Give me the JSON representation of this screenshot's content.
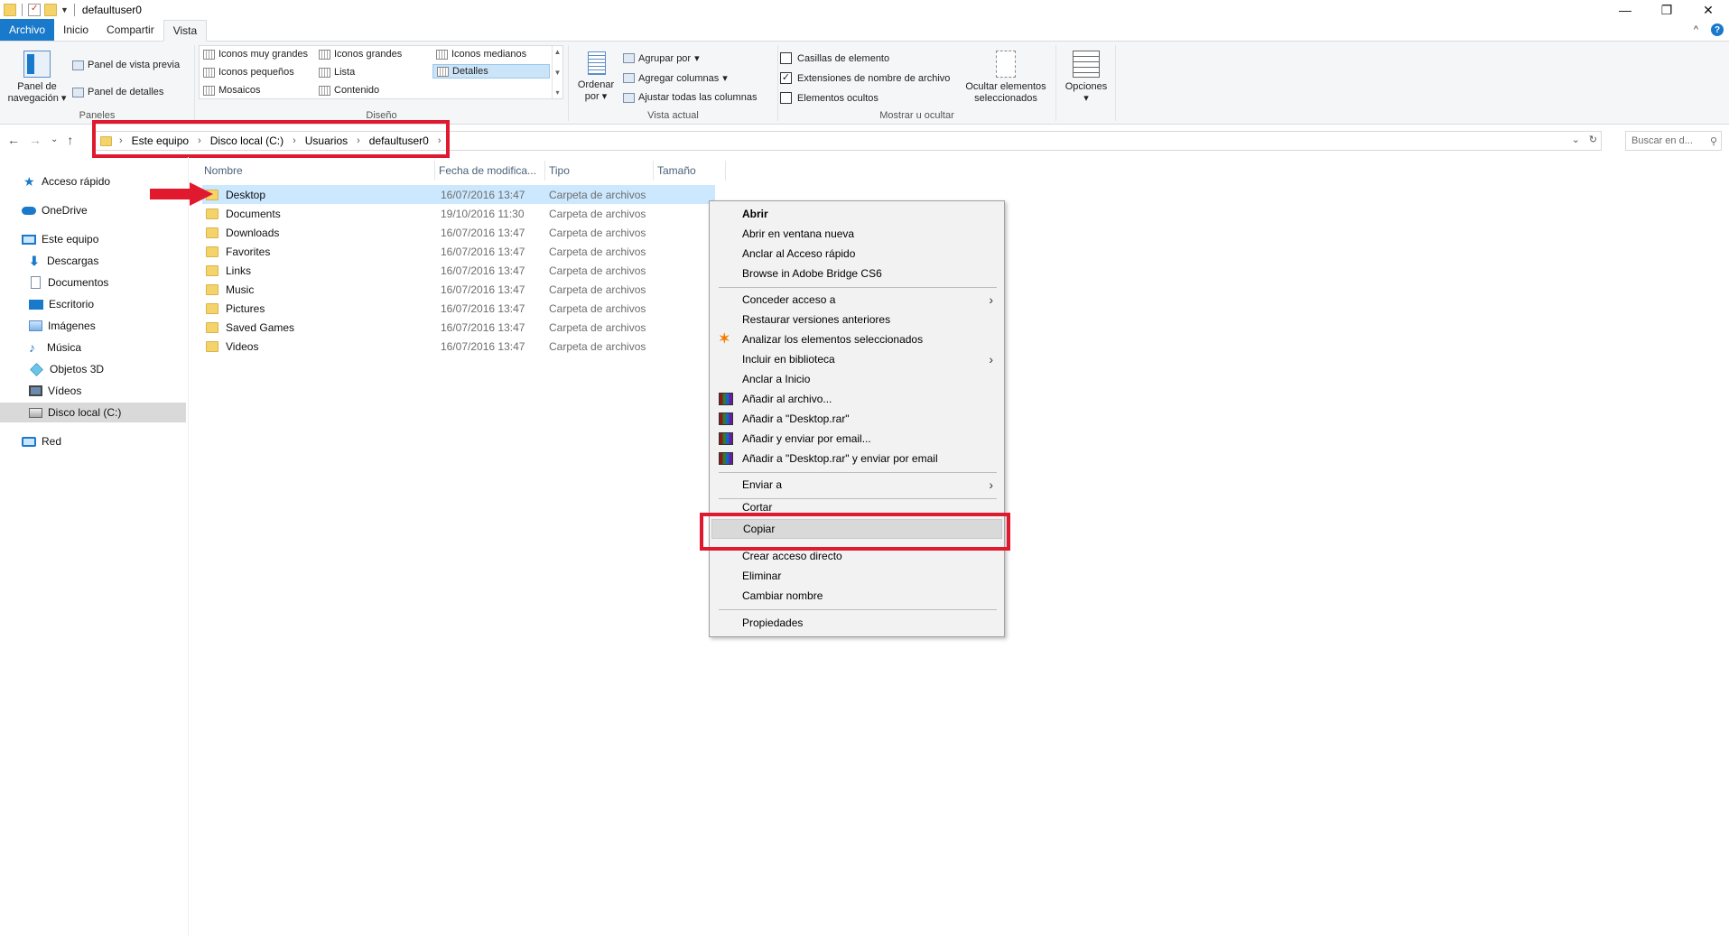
{
  "window": {
    "title": "defaultuser0"
  },
  "ribbon_tabs": [
    "Archivo",
    "Inicio",
    "Compartir",
    "Vista"
  ],
  "ribbon": {
    "paneles": {
      "label": "Paneles",
      "nav_pane": "Panel de navegación",
      "preview_pane": "Panel de vista previa",
      "details_pane": "Panel de detalles"
    },
    "diseno": {
      "label": "Diseño",
      "items": [
        "Iconos muy grandes",
        "Iconos grandes",
        "Iconos medianos",
        "Iconos pequeños",
        "Lista",
        "Detalles",
        "Mosaicos",
        "Contenido"
      ],
      "selected": "Detalles"
    },
    "vista_actual": {
      "label": "Vista actual",
      "sort_by": "Ordenar por",
      "group_by": "Agrupar por",
      "add_columns": "Agregar columnas",
      "fit_columns": "Ajustar todas las columnas"
    },
    "mostrar": {
      "label": "Mostrar u ocultar",
      "item_checkboxes": "Casillas de elemento",
      "file_extensions": "Extensiones de nombre de archivo",
      "hidden_items": "Elementos ocultos",
      "hide_selected": "Ocultar elementos seleccionados"
    },
    "options": "Opciones"
  },
  "address": {
    "crumbs": [
      "Este equipo",
      "Disco local (C:)",
      "Usuarios",
      "defaultuser0"
    ],
    "search_placeholder": "Buscar en d..."
  },
  "sidebar": {
    "items": [
      "Acceso rápido",
      "OneDrive",
      "Este equipo",
      "Descargas",
      "Documentos",
      "Escritorio",
      "Imágenes",
      "Música",
      "Objetos 3D",
      "Vídeos",
      "Disco local (C:)",
      "Red"
    ],
    "selected": "Disco local (C:)"
  },
  "file_list": {
    "columns": [
      "Nombre",
      "Fecha de modifica...",
      "Tipo",
      "Tamaño"
    ],
    "rows": [
      {
        "name": "Desktop",
        "date": "16/07/2016 13:47",
        "type": "Carpeta de archivos"
      },
      {
        "name": "Documents",
        "date": "19/10/2016 11:30",
        "type": "Carpeta de archivos"
      },
      {
        "name": "Downloads",
        "date": "16/07/2016 13:47",
        "type": "Carpeta de archivos"
      },
      {
        "name": "Favorites",
        "date": "16/07/2016 13:47",
        "type": "Carpeta de archivos"
      },
      {
        "name": "Links",
        "date": "16/07/2016 13:47",
        "type": "Carpeta de archivos"
      },
      {
        "name": "Music",
        "date": "16/07/2016 13:47",
        "type": "Carpeta de archivos"
      },
      {
        "name": "Pictures",
        "date": "16/07/2016 13:47",
        "type": "Carpeta de archivos"
      },
      {
        "name": "Saved Games",
        "date": "16/07/2016 13:47",
        "type": "Carpeta de archivos"
      },
      {
        "name": "Videos",
        "date": "16/07/2016 13:47",
        "type": "Carpeta de archivos"
      }
    ],
    "selected": "Desktop"
  },
  "context_menu": {
    "items": [
      "Abrir",
      "Abrir en ventana nueva",
      "Anclar al Acceso rápido",
      "Browse in Adobe Bridge CS6",
      "Conceder acceso a",
      "Restaurar versiones anteriores",
      "Analizar los elementos seleccionados",
      "Incluir en biblioteca",
      "Anclar a Inicio",
      "Añadir al archivo...",
      "Añadir a \"Desktop.rar\"",
      "Añadir y enviar por email...",
      "Añadir a \"Desktop.rar\" y enviar por email",
      "Enviar a",
      "Cortar",
      "Copiar",
      "Crear acceso directo",
      "Eliminar",
      "Cambiar nombre",
      "Propiedades"
    ],
    "highlighted": "Copiar"
  },
  "colors": {
    "accent": "#1979ca",
    "annotation_red": "#e0192e",
    "selection": "#cce8ff"
  }
}
